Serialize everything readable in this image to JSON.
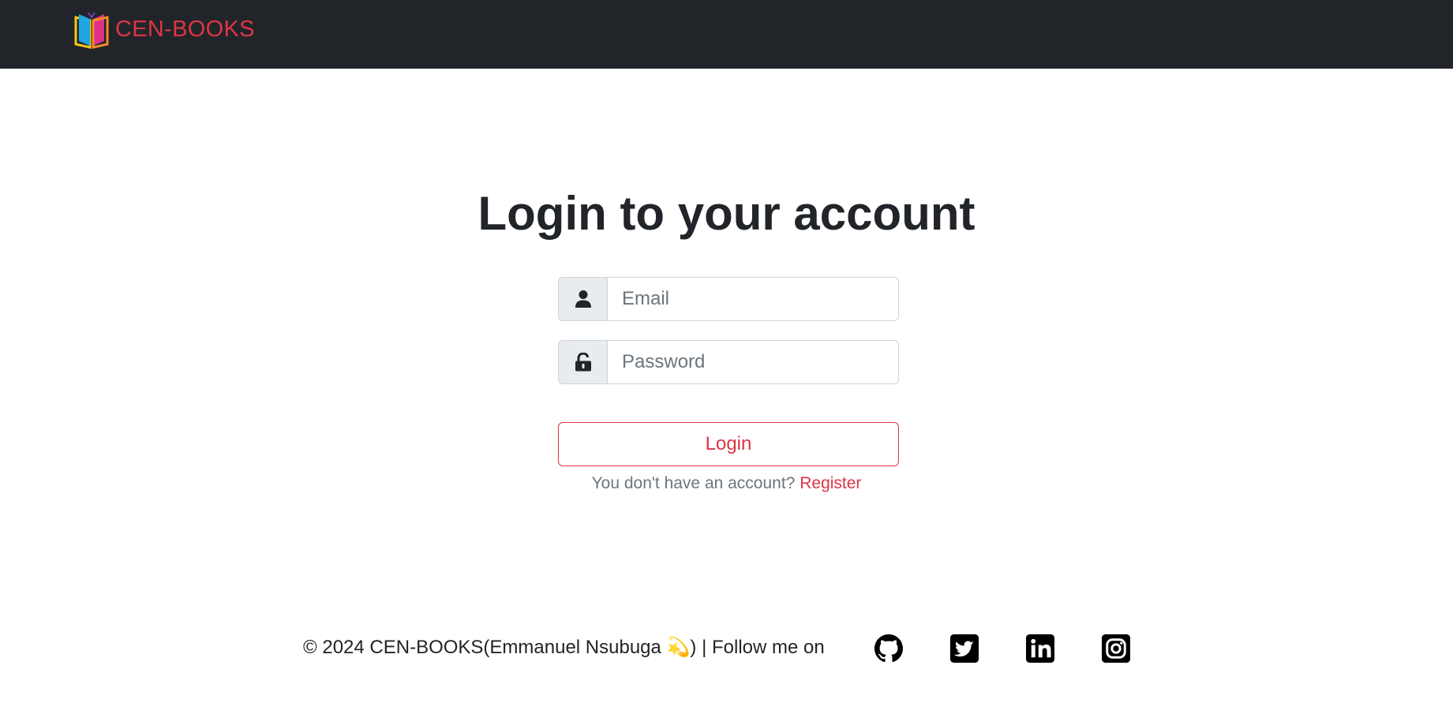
{
  "navbar": {
    "brand_text": "CEN-BOOKS",
    "brand_color": "#dc3545",
    "background": "#212529"
  },
  "login": {
    "title": "Login to your account",
    "email": {
      "placeholder": "Email",
      "value": "",
      "icon": "user-icon"
    },
    "password": {
      "placeholder": "Password",
      "value": "",
      "icon": "lock-open-icon"
    },
    "button_label": "Login",
    "register_prompt": "You don't have an account?",
    "register_link": "Register"
  },
  "footer": {
    "text": "© 2024 CEN-BOOKS(Emmanuel Nsubuga 💫) | Follow me on",
    "social": [
      "github-icon",
      "twitter-icon",
      "linkedin-icon",
      "instagram-icon"
    ]
  },
  "colors": {
    "accent": "#dc3545",
    "text": "#212529",
    "muted": "#6c757d",
    "input_addon_bg": "#e9ecef",
    "border": "#ced4da"
  }
}
